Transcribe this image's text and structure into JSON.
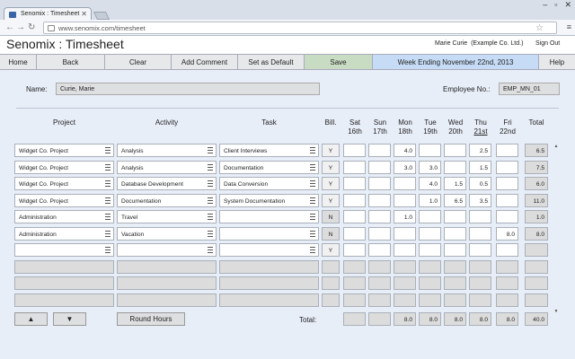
{
  "browser": {
    "tab_title": "Senomix : Timesheet",
    "url": "www.senomix.com/timesheet"
  },
  "app": {
    "title": "Senomix : Timesheet",
    "user": "Marie Curie  (Example Co. Ltd.)",
    "signout": "Sign Out"
  },
  "toolbar": {
    "home": "Home",
    "back": "Back",
    "clear": "Clear",
    "add_comment": "Add Comment",
    "set_default": "Set as Default",
    "save": "Save",
    "week": "Week Ending November 22nd, 2013",
    "help": "Help"
  },
  "form": {
    "name_label": "Name:",
    "name_value": "Curie, Marie",
    "emp_label": "Employee No.:",
    "emp_value": "EMP_MN_01"
  },
  "columns": {
    "project": "Project",
    "activity": "Activity",
    "task": "Task",
    "bill": "Bill.",
    "days": [
      {
        "d": "Sat",
        "n": "16th"
      },
      {
        "d": "Sun",
        "n": "17th"
      },
      {
        "d": "Mon",
        "n": "18th"
      },
      {
        "d": "Tue",
        "n": "19th"
      },
      {
        "d": "Wed",
        "n": "20th"
      },
      {
        "d": "Thu",
        "n": "21st"
      },
      {
        "d": "Fri",
        "n": "22nd"
      }
    ],
    "total": "Total"
  },
  "rows": [
    {
      "project": "Widget Co. Project",
      "activity": "Analysis",
      "task": "Client Interviews",
      "bill": "Y",
      "hours": [
        "",
        "",
        "4.0",
        "",
        "",
        "2.5",
        ""
      ],
      "total": "6.5"
    },
    {
      "project": "Widget Co. Project",
      "activity": "Analysis",
      "task": "Documentation",
      "bill": "Y",
      "hours": [
        "",
        "",
        "3.0",
        "3.0",
        "",
        "1.5",
        ""
      ],
      "total": "7.5"
    },
    {
      "project": "Widget Co. Project",
      "activity": "Database Development",
      "task": "Data Conversion",
      "bill": "Y",
      "hours": [
        "",
        "",
        "",
        "4.0",
        "1.5",
        "0.5",
        ""
      ],
      "total": "6.0"
    },
    {
      "project": "Widget Co. Project",
      "activity": "Documentation",
      "task": "System Documentation",
      "bill": "Y",
      "hours": [
        "",
        "",
        "",
        "1.0",
        "6.5",
        "3.5",
        ""
      ],
      "total": "11.0"
    },
    {
      "project": "Administration",
      "activity": "Travel",
      "task": "",
      "bill": "N",
      "hours": [
        "",
        "",
        "1.0",
        "",
        "",
        "",
        ""
      ],
      "total": "1.0"
    },
    {
      "project": "Administration",
      "activity": "Vacation",
      "task": "",
      "bill": "N",
      "hours": [
        "",
        "",
        "",
        "",
        "",
        "",
        "8.0"
      ],
      "total": "8.0"
    },
    {
      "project": "",
      "activity": "",
      "task": "",
      "bill": "Y",
      "hours": [
        "",
        "",
        "",
        "",
        "",
        "",
        ""
      ],
      "total": ""
    }
  ],
  "footer": {
    "up": "▲",
    "down": "▼",
    "round_hours": "Round Hours",
    "total_label": "Total:",
    "day_totals": [
      "",
      "",
      "8.0",
      "8.0",
      "8.0",
      "8.0",
      "8.0"
    ],
    "grand_total": "40.0"
  }
}
